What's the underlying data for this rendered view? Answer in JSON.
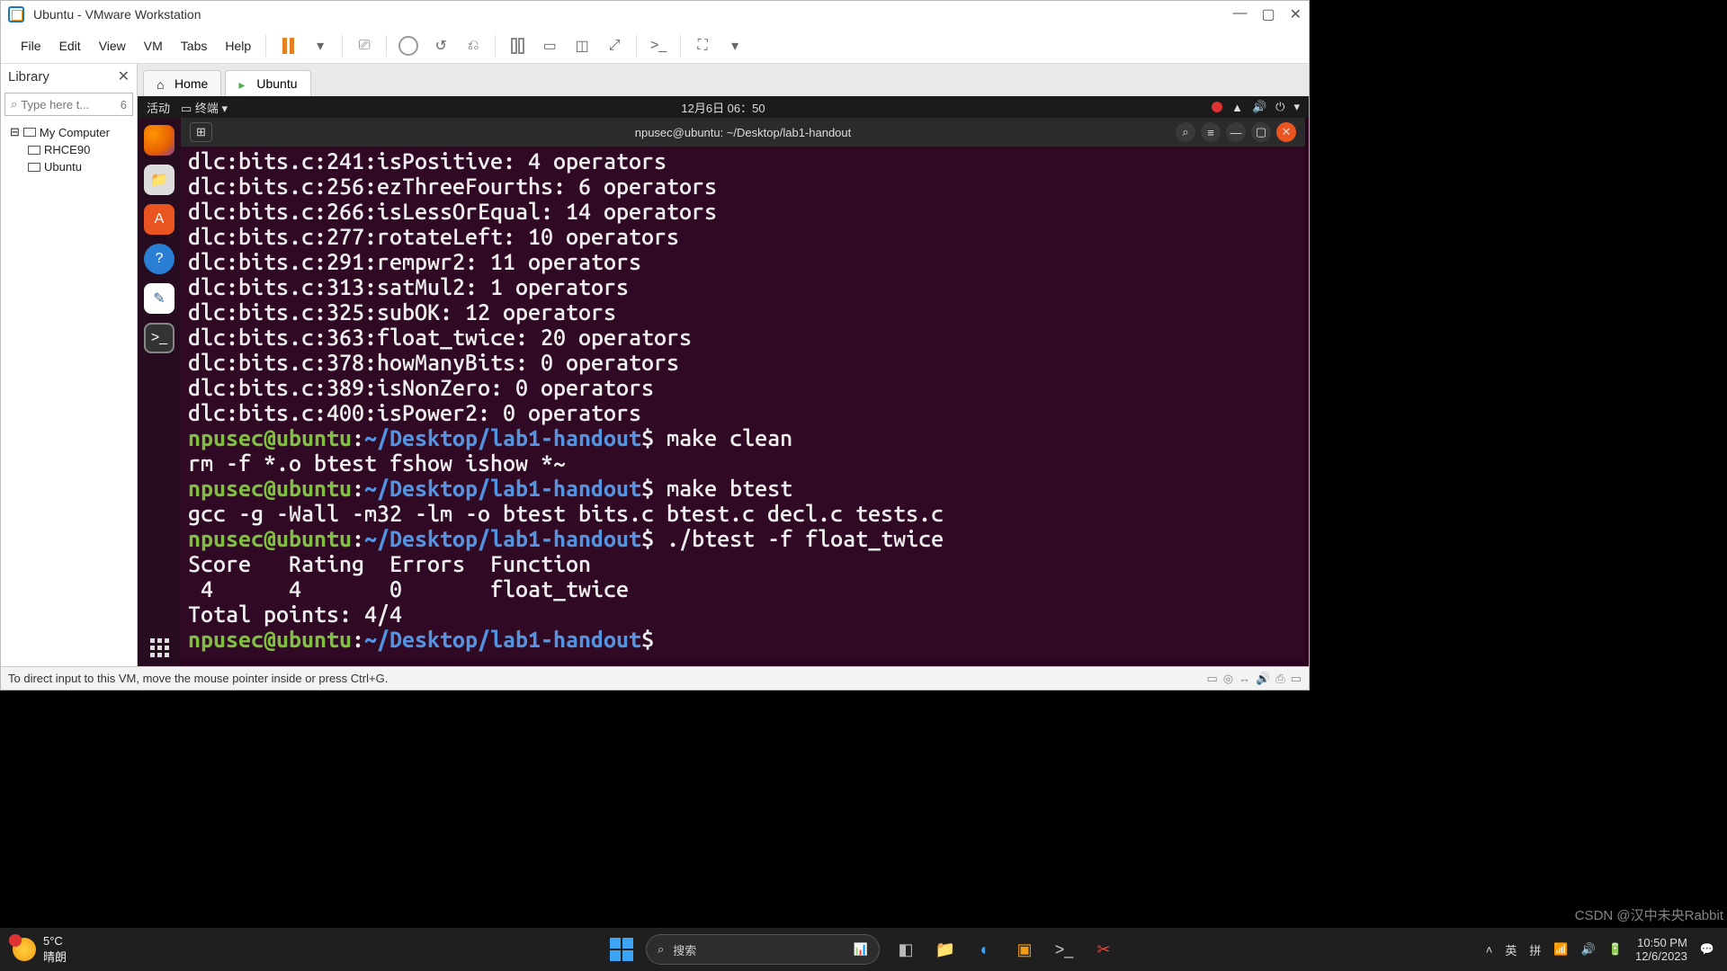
{
  "vmware": {
    "title": "Ubuntu - VMware Workstation",
    "menu": [
      "File",
      "Edit",
      "View",
      "VM",
      "Tabs",
      "Help"
    ],
    "library_label": "Library",
    "search_placeholder": "Type here t...",
    "search_badge": "6",
    "tree": {
      "root": "My Computer",
      "children": [
        "RHCE90",
        "Ubuntu"
      ]
    },
    "tabs": {
      "home": "Home",
      "ubuntu": "Ubuntu"
    },
    "status": "To direct input to this VM, move the mouse pointer inside or press Ctrl+G."
  },
  "gnome": {
    "activities": "活动",
    "app_label": "终端",
    "datetime": "12月6日 06：50"
  },
  "terminal": {
    "title": "npusec@ubuntu: ~/Desktop/lab1-handout",
    "dlc_lines": [
      "dlc:bits.c:241:isPositive: 4 operators",
      "dlc:bits.c:256:ezThreeFourths: 6 operators",
      "dlc:bits.c:266:isLessOrEqual: 14 operators",
      "dlc:bits.c:277:rotateLeft: 10 operators",
      "dlc:bits.c:291:rempwr2: 11 operators",
      "dlc:bits.c:313:satMul2: 1 operators",
      "dlc:bits.c:325:subOK: 12 operators",
      "dlc:bits.c:363:float_twice: 20 operators",
      "dlc:bits.c:378:howManyBits: 0 operators",
      "dlc:bits.c:389:isNonZero: 0 operators",
      "dlc:bits.c:400:isPower2: 0 operators"
    ],
    "prompt_user": "npusec@ubuntu",
    "prompt_path": "~/Desktop/lab1-handout",
    "cmd1": "make clean",
    "out1": "rm -f *.o btest fshow ishow *~",
    "cmd2": "make btest",
    "out2": "gcc -g -Wall -m32 -lm -o btest bits.c btest.c decl.c tests.c",
    "cmd3": "./btest -f float_twice",
    "hdr": "Score   Rating  Errors  Function",
    "row": " 4      4       0       float_twice",
    "total": "Total points: 4/4"
  },
  "windows": {
    "temp": "5°C",
    "cond": "晴朗",
    "search": "搜索",
    "ime1": "英",
    "ime2": "拼",
    "time": "10:50 PM",
    "date": "12/6/2023"
  },
  "watermark": "CSDN @汉中未央Rabbit"
}
